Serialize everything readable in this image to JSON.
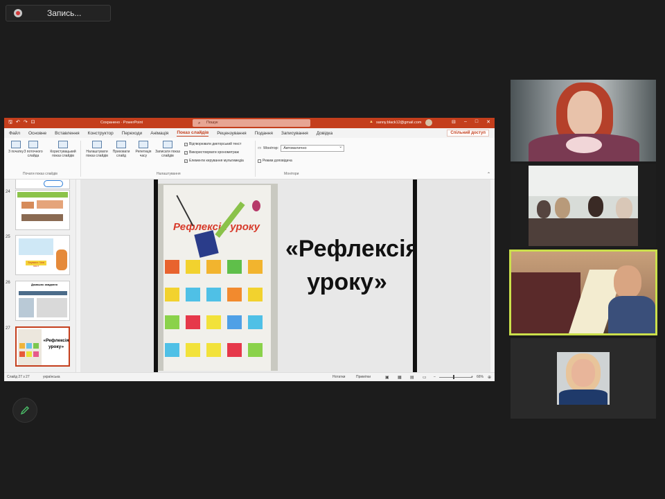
{
  "recording": {
    "label": "Запись..."
  },
  "ppt": {
    "titlebar": {
      "title": "Сохранено · PowerPoint",
      "search_placeholder": "Пошук",
      "user_email": "sanny.black12@gmail.com"
    },
    "tabs": [
      "Файл",
      "Основне",
      "Вставлення",
      "Конструктор",
      "Переходи",
      "Анімація",
      "Показ слайдів",
      "Рецензування",
      "Подання",
      "Записування",
      "Довідка"
    ],
    "active_tab": "Показ слайдів",
    "share_label": "Спільний доступ",
    "ribbon": {
      "btn_from_start": "З початку",
      "btn_from_current": "З поточного слайда",
      "btn_custom": "Користувацький показ слайдів",
      "group_start": "Почати показ слайдів",
      "btn_setup": "Налаштувати показ слайдів",
      "btn_hide": "Приховати слайд",
      "btn_rehearse": "Репетиція часу",
      "btn_record": "Записати показ слайдів",
      "check_narration": "Відтворювати дикторський текст",
      "check_timings": "Використовувати хронометраж",
      "check_media": "Елементи керування мультимедіа",
      "group_setup": "Налаштування",
      "monitor_label": "Монітор:",
      "monitor_value": "Автоматично",
      "presenter_view": "Режим доповідача",
      "group_monitors": "Монітори"
    },
    "thumbnails": [
      {
        "num": "24"
      },
      {
        "num": "25",
        "text": "Заувага: Чия лист"
      },
      {
        "num": "26",
        "text": "Домашнє завдання"
      },
      {
        "num": "27",
        "text": "«Рефлексія уроку»"
      }
    ],
    "slide": {
      "poster_title": "Рефлексія уроку",
      "text_line1": "«Рефлексія",
      "text_line2": "уроку»"
    },
    "statusbar": {
      "slide_pos": "Слайд 27 з 27",
      "language": "українська",
      "notes": "Нотатки",
      "comments": "Примітки",
      "zoom": "66%"
    }
  }
}
